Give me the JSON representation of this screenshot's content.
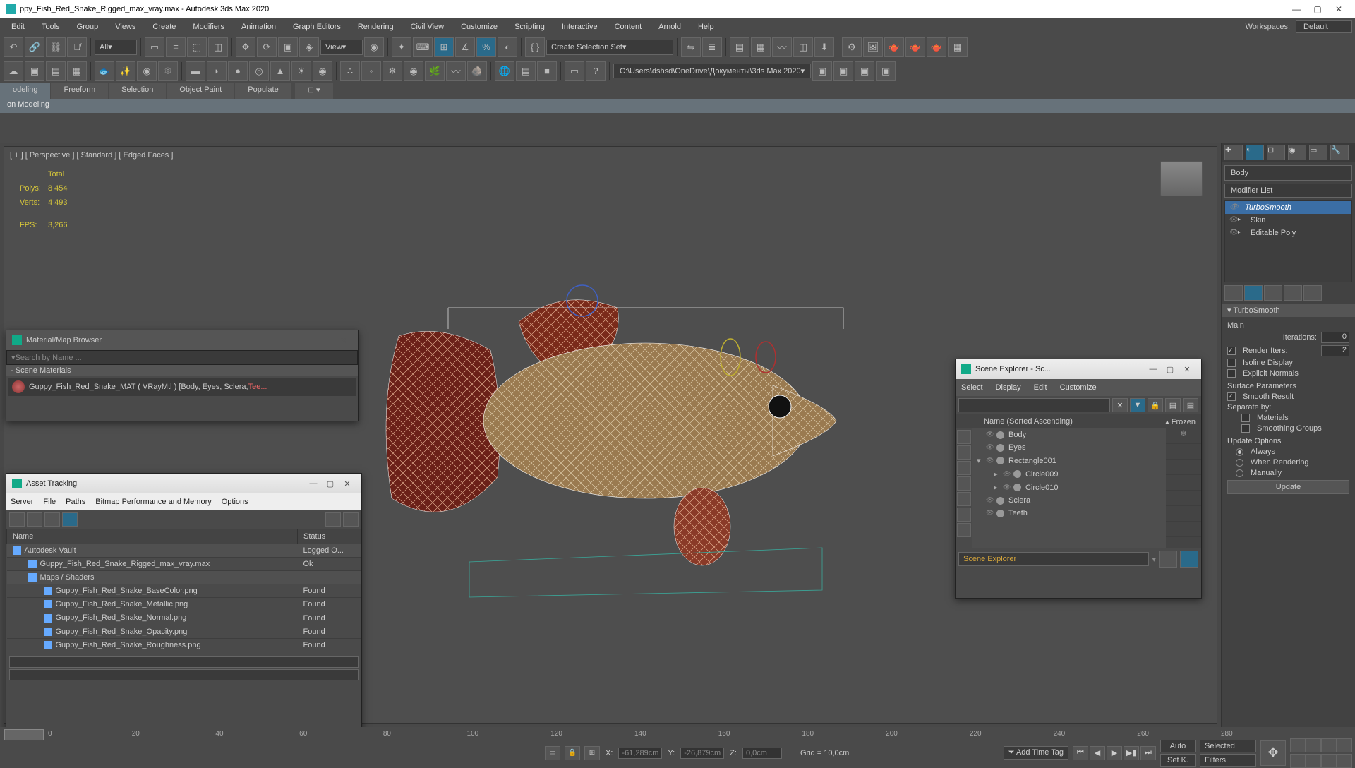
{
  "titlebar": {
    "title": "ppy_Fish_Red_Snake_Rigged_max_vray.max - Autodesk 3ds Max 2020"
  },
  "menu": [
    "Edit",
    "Tools",
    "Group",
    "Views",
    "Create",
    "Modifiers",
    "Animation",
    "Graph Editors",
    "Rendering",
    "Civil View",
    "Customize",
    "Scripting",
    "Interactive",
    "Content",
    "Arnold",
    "Help"
  ],
  "workspaces": {
    "label": "Workspaces:",
    "value": "Default"
  },
  "toolbar1": {
    "all": "All",
    "view": "View",
    "sel_set": "Create Selection Set"
  },
  "toolbar2": {
    "path": "C:\\Users\\dshsd\\OneDrive\\Документы\\3ds Max 2020"
  },
  "ribbon": {
    "tabs": [
      "odeling",
      "Freeform",
      "Selection",
      "Object Paint",
      "Populate"
    ],
    "sub": "on Modeling"
  },
  "viewport": {
    "label": "[ + ] [ Perspective ] [ Standard ] [ Edged Faces ]",
    "stats": {
      "totalLabel": "Total",
      "polysLabel": "Polys:",
      "polys": "8 454",
      "vertsLabel": "Verts:",
      "verts": "4 493",
      "fpsLabel": "FPS:",
      "fps": "3,266"
    }
  },
  "matbrowser": {
    "title": "Material/Map Browser",
    "search": "Search by Name ...",
    "category": "Scene Materials",
    "item_name": "Guppy_Fish_Red_Snake_MAT  ( VRayMtl )  [Body, Eyes, Sclera, ",
    "item_extra": "Tee..."
  },
  "asset": {
    "title": "Asset Tracking",
    "menu": [
      "Server",
      "File",
      "Paths",
      "Bitmap Performance and Memory",
      "Options"
    ],
    "cols": [
      "Name",
      "Status"
    ],
    "rows": [
      {
        "name": "Autodesk Vault",
        "status": "Logged O...",
        "cat": true,
        "icon": "vault"
      },
      {
        "name": "Guppy_Fish_Red_Snake_Rigged_max_vray.max",
        "status": "Ok",
        "icon": "max",
        "indent": 1
      },
      {
        "name": "Maps / Shaders",
        "status": "",
        "cat": true,
        "icon": "folder",
        "indent": 1
      },
      {
        "name": "Guppy_Fish_Red_Snake_BaseColor.png",
        "status": "Found",
        "icon": "img",
        "indent": 2
      },
      {
        "name": "Guppy_Fish_Red_Snake_Metallic.png",
        "status": "Found",
        "icon": "img",
        "indent": 2
      },
      {
        "name": "Guppy_Fish_Red_Snake_Normal.png",
        "status": "Found",
        "icon": "img",
        "indent": 2
      },
      {
        "name": "Guppy_Fish_Red_Snake_Opacity.png",
        "status": "Found",
        "icon": "img",
        "indent": 2
      },
      {
        "name": "Guppy_Fish_Red_Snake_Roughness.png",
        "status": "Found",
        "icon": "img",
        "indent": 2
      }
    ]
  },
  "scene": {
    "title": "Scene Explorer - Sc...",
    "menu": [
      "Select",
      "Display",
      "Edit",
      "Customize"
    ],
    "col_name": "Name (Sorted Ascending)",
    "col_frozen": "Frozen",
    "nodes": [
      {
        "name": "Body",
        "depth": 0,
        "frozen": true
      },
      {
        "name": "Eyes",
        "depth": 0
      },
      {
        "name": "Rectangle001",
        "depth": 0,
        "expanded": true
      },
      {
        "name": "Circle009",
        "depth": 1,
        "hasChildren": true
      },
      {
        "name": "Circle010",
        "depth": 1,
        "hasChildren": true
      },
      {
        "name": "Sclera",
        "depth": 0
      },
      {
        "name": "Teeth",
        "depth": 0
      }
    ],
    "footer_label": "Scene Explorer"
  },
  "mod": {
    "objname": "Body",
    "modifierList": "Modifier List",
    "stack": [
      "TurboSmooth",
      "Skin",
      "Editable Poly"
    ],
    "rollout": "TurboSmooth",
    "main": "Main",
    "iter_label": "Iterations:",
    "iter": "0",
    "rend_label": "Render Iters:",
    "rend": "2",
    "iso": "Isoline Display",
    "expl": "Explicit Normals",
    "surf": "Surface Parameters",
    "smooth": "Smooth Result",
    "sep": "Separate by:",
    "materials": "Materials",
    "sgroups": "Smoothing Groups",
    "updopt": "Update Options",
    "always": "Always",
    "whenrend": "When Rendering",
    "manual": "Manually",
    "update": "Update"
  },
  "timeline": {
    "ticks": [
      "0",
      "20",
      "40",
      "60",
      "80",
      "100",
      "120",
      "140",
      "160",
      "180",
      "200",
      "220",
      "240",
      "260",
      "280"
    ]
  },
  "status": {
    "x": "X:",
    "xv": "-61,289cm",
    "y": "Y:",
    "yv": "-26,879cm",
    "z": "Z:",
    "zv": "0,0cm",
    "grid": "Grid = 10,0cm",
    "addtag": "Add Time Tag",
    "auto": "Auto",
    "setk": "Set K.",
    "selected": "Selected",
    "filters": "Filters..."
  }
}
